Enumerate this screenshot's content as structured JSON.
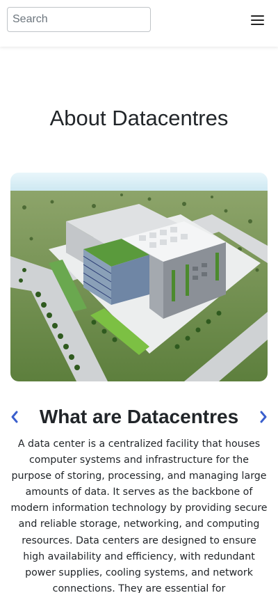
{
  "search": {
    "placeholder": "Search",
    "value": ""
  },
  "header": {
    "menu_icon": "hamburger-menu-icon"
  },
  "page": {
    "title": "About Datacentres"
  },
  "hero": {
    "image_alt": "aerial rendering of a data center campus"
  },
  "carousel": {
    "title": "What are Datacentres",
    "prev_icon": "chevron-left-icon",
    "next_icon": "chevron-right-icon",
    "text": "A data center is a centralized facility that houses computer systems and infrastructure for the purpose of storing, processing, and managing large amounts of data. It serves as the backbone of modern information technology by providing secure and reliable storage, networking, and computing resources. Data centers are designed to ensure high availability and efficiency, with redundant power supplies, cooling systems, and network connections. They are essential for"
  },
  "colors": {
    "accent_arrow": "#3a5fcd",
    "text": "#212529",
    "grass": "#6f8f4e"
  }
}
